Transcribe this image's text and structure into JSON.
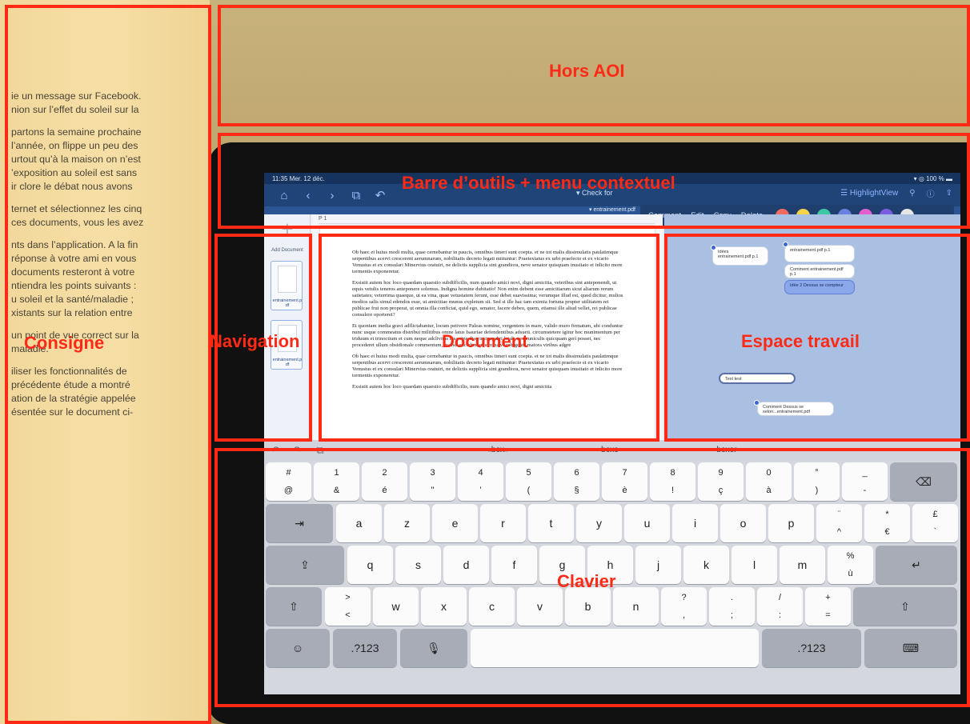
{
  "paper_text": [
    "ie un message sur Facebook.",
    "nion sur l’effet du soleil sur la",
    "",
    "partons la semaine prochaine",
    "l’année, on flippe un peu des",
    "urtout qu’à la maison on n’est",
    "’exposition au soleil est sans",
    "ir clore le débat nous avons",
    "",
    "ternet et sélectionnez les cinq",
    "ces documents, vous les avez",
    "",
    "nts dans l’application. A la fin",
    "réponse à votre ami en vous",
    "documents resteront à votre",
    "ntiendra les points suivants :",
    "u soleil et la santé/maladie ;",
    "xistants sur la relation entre",
    "",
    "un point de vue correct sur la",
    "maladie.",
    "",
    "iliser les fonctionnalités de",
    "précédente étude a montré",
    "ation de la stratégie appelée",
    "ésentée sur le document ci-"
  ],
  "status": {
    "time": "11:35 Mer. 12 déc.",
    "battery": "100 %"
  },
  "toolbar": {
    "check_for": "Check for",
    "highlightview": "HighlightView"
  },
  "document": {
    "filename": "entrainement.pdf",
    "page_label": "P 1"
  },
  "context_menu": {
    "items": [
      "Comment",
      "Edit",
      "Copy",
      "Delete"
    ],
    "colors": [
      "#ef6a5f",
      "#f3d34a",
      "#3ec7a4",
      "#6b7fe0",
      "#e35fcf",
      "#7a5de0",
      "#e6e6e6"
    ]
  },
  "nav": {
    "add_label": "Add Document",
    "thumbs": [
      "entrainement.p df",
      "entrainement.p df"
    ]
  },
  "doc_paragraphs": [
    "Ob haec et huius modi multa, quae cernebantur in paucis, omnibus timeri sunt coepta. et ne tot malis dissimulatis paulatimque serpentibus acervi crescerent aerumnarum, nobilitatis decreto legati mittuntur: Praetextatus ex urbi praefecto et ex vicario Venustus et ex consulari Minervius oratuiri, ne delictis supplicia sint grandiora, neve senator quisquam inusitato et inlicito more tormentis exponeretur.",
    "Exsistit autem hoc loco quaedam quaestio subdifficilis, num quando amici novi, digni amicitia, veteribus sint anteponendi, ut equis vetulis teneros anteponere solemus. Indigna homine dubitatio! Non enim debent esse amicitiarum sicut aliarum rerum satietates; veterrima quaeque, ut ea vina, quae vetustatem ferunt, esse debet suavissima; verumque illud est, quod dicitur, multos modios salis simul edendos esse, ut amicitiae munus expletum sit. Sed si ille hac tam eximia fortuna propter utilitatem rei publicae frui non properat, ut omnia illa conficiat, quid ego, senator, facere debeo, quem, etiamsi ille aliud vellet, rei publicae consulere oporteret?",
    "Et quoniam inedia gravi adflictabantur, locum petivere Paleas nomine, vergentem in mare, valido muro firmatum, ubi conduntur nunc usque commeatus distribui militibus omne latus Isauriae defendentibus adsueti. circumstetere igitur hoc munimentum per triduum et trinoctium et cum neque adclivitas ipsa sine discrimine adiri letali, nec cuniculis quicquam gerì posset, nec procederet ullum obsidionale commentum, maesti excedunt postrema vi subigente maiora viribus adgre",
    "Ob haec et huius modi multa, quae cernebantur in paucis, omnibus timeri sunt coepta. et ne tot malis dissimulatis paulatimque serpentibus acervi crescerent aerumnarum, nobilitatis decreto legati mittuntur: Praetextatus ex urbi praefecto et ex vicario Venustus et ex consulari Minervius oratuiri, ne delictis supplicia sint grandiora, neve senator quisquam inusitato et inlicito more tormentis exponeretur.",
    "Exsistit autem hoc loco quaedam quaestio subdifficilis, num quando amici novi, digni amicitia"
  ],
  "workspace": {
    "cards": [
      "entrainement.pdf p.1",
      "Idées",
      "entrainement.pdf p.1",
      "Comment",
      "entrainement.pdf p.1",
      "Idée 2",
      "Dessus se compteur",
      "Text test",
      "Comment",
      "Dessus se selon...entrainement.pdf"
    ]
  },
  "keyboard": {
    "suggestions": [
      "«box»",
      "boxe",
      "boxer"
    ],
    "row1": [
      {
        "t": "#",
        "b": "@"
      },
      {
        "t": "1",
        "b": "&"
      },
      {
        "t": "2",
        "b": "é"
      },
      {
        "t": "3",
        "b": "\""
      },
      {
        "t": "4",
        "b": "’"
      },
      {
        "t": "5",
        "b": "("
      },
      {
        "t": "6",
        "b": "§"
      },
      {
        "t": "7",
        "b": "è"
      },
      {
        "t": "8",
        "b": "!"
      },
      {
        "t": "9",
        "b": "ç"
      },
      {
        "t": "0",
        "b": "à"
      },
      {
        "t": "°",
        "b": ")"
      },
      {
        "t": "_",
        "b": "-"
      }
    ],
    "row2": [
      "a",
      "z",
      "e",
      "r",
      "t",
      "y",
      "u",
      "i",
      "o",
      "p"
    ],
    "row2_extra": [
      {
        "t": "¨",
        "b": "^"
      },
      {
        "t": "*",
        "b": "€"
      },
      {
        "t": "£",
        "b": "`"
      }
    ],
    "row3": [
      "q",
      "s",
      "d",
      "f",
      "g",
      "h",
      "j",
      "k",
      "l",
      "m"
    ],
    "row3_extra": {
      "t": "%",
      "b": "ù"
    },
    "row4_first": {
      "t": ">",
      "b": "<"
    },
    "row4": [
      "w",
      "x",
      "c",
      "v",
      "b",
      "n"
    ],
    "row4_extra": [
      {
        "t": "?",
        "b": ","
      },
      {
        "t": ".",
        "b": ";"
      },
      {
        "t": "/",
        "b": ":"
      },
      {
        "t": "+",
        "b": "="
      }
    ],
    "num_key": ".?123",
    "num_key_right": ".?123"
  },
  "aoi": {
    "hors": "Hors AOI",
    "barre": "Barre d’outils + menu contextuel",
    "navigation": "Navigation",
    "document": "Document",
    "espace": "Espace travail",
    "consigne": "Consigne",
    "clavier": "Clavier"
  },
  "colors": {
    "aoi": "#ff2a16",
    "appbar": "#1f4478",
    "workspace": "#aac0e2"
  }
}
